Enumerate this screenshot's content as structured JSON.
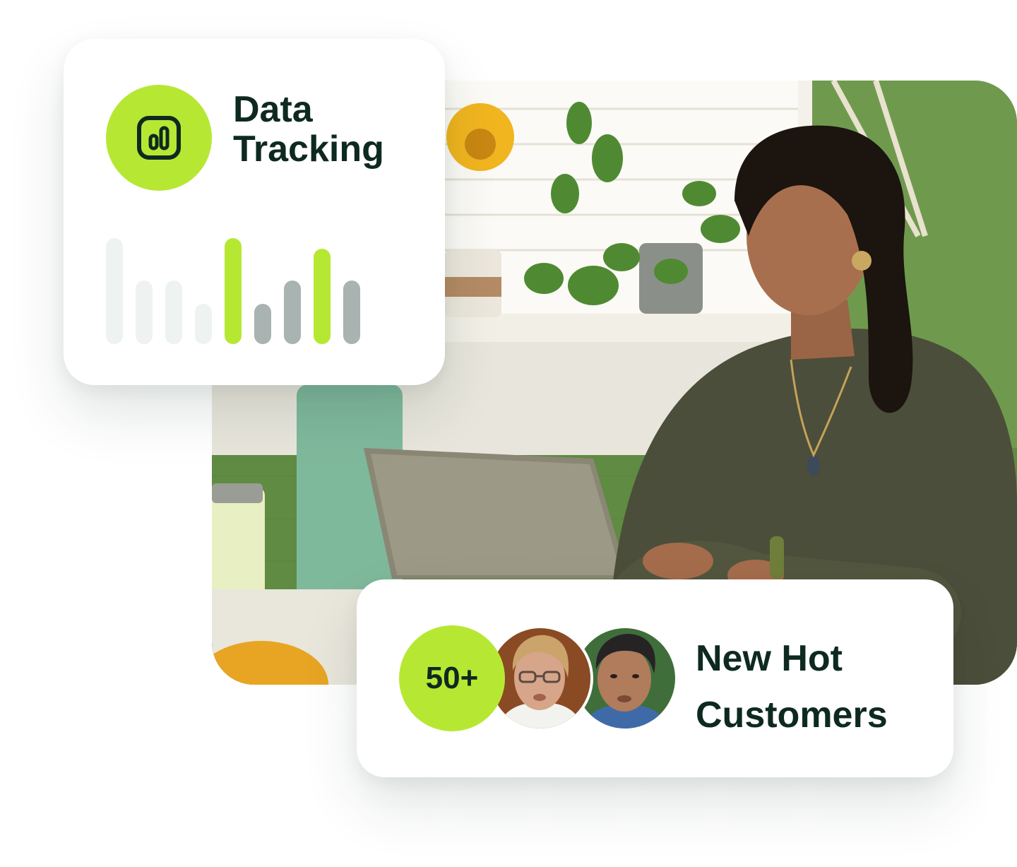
{
  "tracking_card": {
    "title_line1": "Data",
    "title_line2": "Tracking",
    "icon": "bar-chart-icon",
    "bars": [
      {
        "level": 1.0,
        "tone": "light"
      },
      {
        "level": 0.6,
        "tone": "light"
      },
      {
        "level": 0.6,
        "tone": "light"
      },
      {
        "level": 0.38,
        "tone": "light"
      },
      {
        "level": 1.0,
        "tone": "accent"
      },
      {
        "level": 0.38,
        "tone": "dark"
      },
      {
        "level": 0.6,
        "tone": "dark"
      },
      {
        "level": 0.9,
        "tone": "accent"
      },
      {
        "level": 0.6,
        "tone": "dark"
      }
    ]
  },
  "customers_card": {
    "count": "50+",
    "title_line1": "New Hot",
    "title_line2": "Customers",
    "avatars": [
      "avatar-woman-glasses",
      "avatar-man"
    ]
  },
  "photo": {
    "subject": "woman-working-on-tablet"
  },
  "colors": {
    "accent": "#b6e833",
    "text_dark": "#0e2a20",
    "bar_light": "#eef2f1",
    "bar_dark": "#a9b3b1",
    "wall_green": "#6f9a4e"
  }
}
